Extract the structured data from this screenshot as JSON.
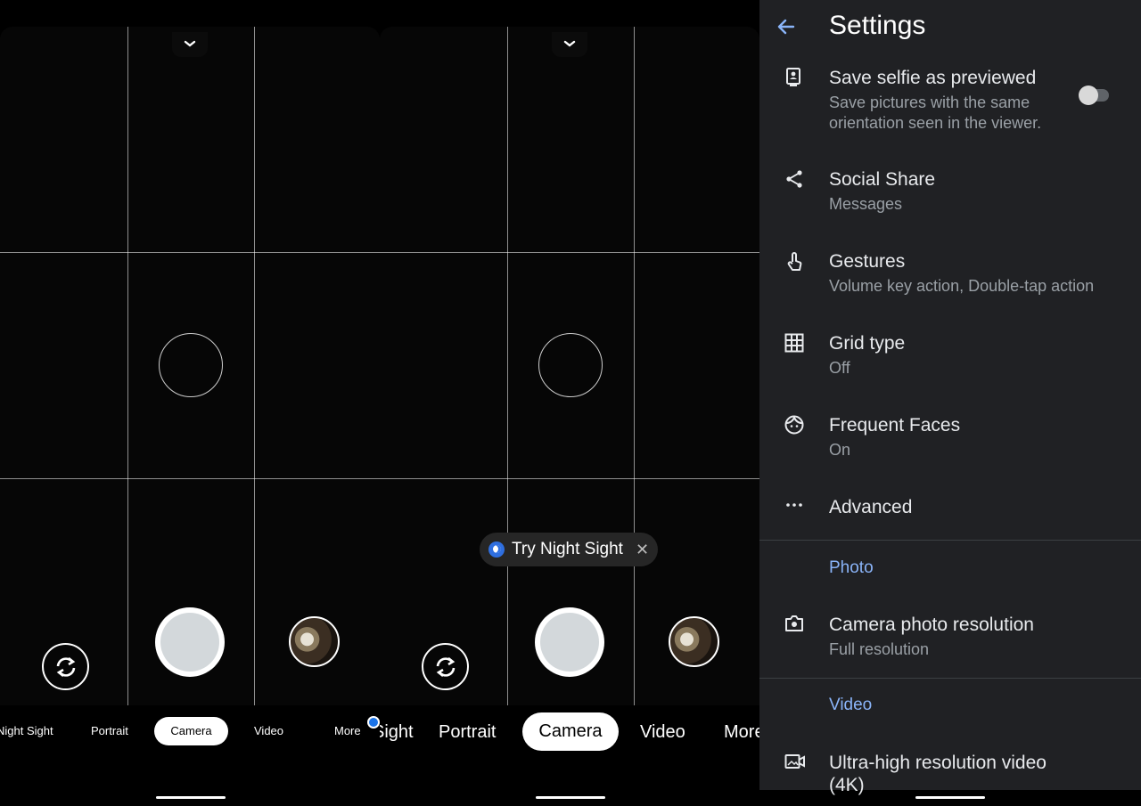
{
  "left_camera": {
    "modes": [
      "Night Sight",
      "Portrait",
      "Camera",
      "Video",
      "More"
    ],
    "active_mode": "Camera"
  },
  "middle_camera": {
    "modes": [
      "Sight",
      "Portrait",
      "Camera",
      "Video",
      "More"
    ],
    "active_mode": "Camera",
    "hint_label": "Try Night Sight",
    "hint_close": "✕"
  },
  "settings": {
    "title": "Settings",
    "items": [
      {
        "title": "Save selfie as previewed",
        "subtitle": "Save pictures with the same",
        "subtitle2": "orientation seen in the viewer.",
        "icon": "selfie-portrait-icon",
        "toggle": "off"
      },
      {
        "title": "Social Share",
        "subtitle": "Messages",
        "icon": "share-icon"
      },
      {
        "title": "Gestures",
        "subtitle": "Volume key action, Double-tap action",
        "icon": "gesture-hand-icon"
      },
      {
        "title": "Grid type",
        "subtitle": "Off",
        "icon": "grid-icon"
      },
      {
        "title": "Frequent Faces",
        "subtitle": "On",
        "icon": "face-icon"
      },
      {
        "title": "Advanced",
        "icon": "more-horiz-icon"
      }
    ],
    "section_photo": "Photo",
    "photo_items": [
      {
        "title": "Camera photo resolution",
        "subtitle": "Full resolution",
        "icon": "camera-icon"
      }
    ],
    "section_video": "Video",
    "video_items": [
      {
        "title": "Ultra-high resolution video",
        "subtitle": "(4K)",
        "icon": "video-camera-icon"
      }
    ]
  },
  "colors": {
    "accent": "#8ab4f8",
    "dot": "#1a73e8",
    "settings_bg": "#202124"
  }
}
